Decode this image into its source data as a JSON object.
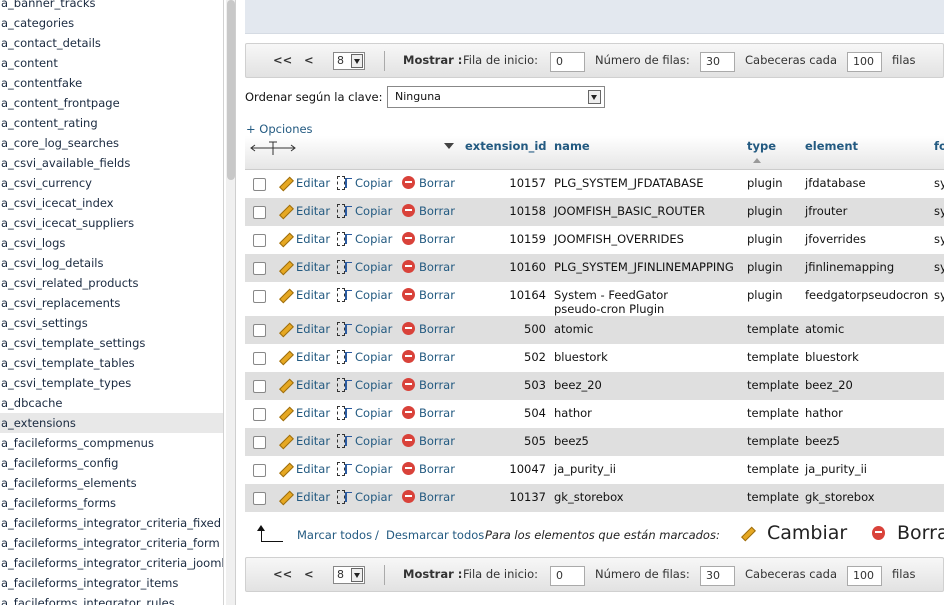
{
  "sidebar": {
    "tables": [
      "a_banner_tracks",
      "a_categories",
      "a_contact_details",
      "a_content",
      "a_contentfake",
      "a_content_frontpage",
      "a_content_rating",
      "a_core_log_searches",
      "a_csvi_available_fields",
      "a_csvi_currency",
      "a_csvi_icecat_index",
      "a_csvi_icecat_suppliers",
      "a_csvi_logs",
      "a_csvi_log_details",
      "a_csvi_related_products",
      "a_csvi_replacements",
      "a_csvi_settings",
      "a_csvi_template_settings",
      "a_csvi_template_tables",
      "a_csvi_template_types",
      "a_dbcache",
      "a_extensions",
      "a_facileforms_compmenus",
      "a_facileforms_config",
      "a_facileforms_elements",
      "a_facileforms_forms",
      "a_facileforms_integrator_criteria_fixed",
      "a_facileforms_integrator_criteria_form",
      "a_facileforms_integrator_criteria_joomla",
      "a_facileforms_integrator_items",
      "a_facileforms_integrator_rules"
    ],
    "active_index": 21
  },
  "nav": {
    "first": "<<",
    "prev": "<",
    "page": "8",
    "show_label": "Mostrar :",
    "start_row_label": "Fila de inicio:",
    "start_row_value": "0",
    "num_rows_label": "Número de filas:",
    "num_rows_value": "30",
    "headers_every_label": "Cabeceras cada",
    "headers_every_value": "100",
    "rows_label": "filas"
  },
  "order": {
    "label": "Ordenar según la clave:",
    "value": "Ninguna"
  },
  "options_link": "+ Opciones",
  "table": {
    "columns": {
      "extension_id": "extension_id",
      "name": "name",
      "type": "type",
      "element": "element",
      "folder": "fo"
    },
    "actions": {
      "edit": "Editar",
      "copy": "Copiar",
      "delete": "Borrar"
    },
    "rows": [
      {
        "id": "10157",
        "name": "PLG_SYSTEM_JFDATABASE",
        "name2": "",
        "type": "plugin",
        "element": "jfdatabase",
        "folder": "sy"
      },
      {
        "id": "10158",
        "name": "JOOMFISH_BASIC_ROUTER",
        "name2": "",
        "type": "plugin",
        "element": "jfrouter",
        "folder": "sy"
      },
      {
        "id": "10159",
        "name": "JOOMFISH_OVERRIDES",
        "name2": "",
        "type": "plugin",
        "element": "jfoverrides",
        "folder": "sy"
      },
      {
        "id": "10160",
        "name": "PLG_SYSTEM_JFINLINEMAPPING",
        "name2": "",
        "type": "plugin",
        "element": "jfinlinemapping",
        "folder": "sy"
      },
      {
        "id": "10164",
        "name": "System - FeedGator",
        "name2": "pseudo-cron Plugin",
        "type": "plugin",
        "element": "feedgatorpseudocron",
        "folder": "sy"
      },
      {
        "id": "500",
        "name": "atomic",
        "name2": "",
        "type": "template",
        "element": "atomic",
        "folder": ""
      },
      {
        "id": "502",
        "name": "bluestork",
        "name2": "",
        "type": "template",
        "element": "bluestork",
        "folder": ""
      },
      {
        "id": "503",
        "name": "beez_20",
        "name2": "",
        "type": "template",
        "element": "beez_20",
        "folder": ""
      },
      {
        "id": "504",
        "name": "hathor",
        "name2": "",
        "type": "template",
        "element": "hathor",
        "folder": ""
      },
      {
        "id": "505",
        "name": "beez5",
        "name2": "",
        "type": "template",
        "element": "beez5",
        "folder": ""
      },
      {
        "id": "10047",
        "name": "ja_purity_ii",
        "name2": "",
        "type": "template",
        "element": "ja_purity_ii",
        "folder": ""
      },
      {
        "id": "10137",
        "name": "gk_storebox",
        "name2": "",
        "type": "template",
        "element": "gk_storebox",
        "folder": ""
      }
    ]
  },
  "footer": {
    "mark_all": "Marcar todos",
    "separator": "/",
    "unmark_all": "Desmarcar todos",
    "for_marked": "Para los elementos que están marcados:",
    "change": "Cambiar",
    "delete": "Borra"
  },
  "colors": {
    "link": "#235a81",
    "row_alt": "#dfdfdf",
    "delete_icon": "#d9423a",
    "edit_icon": "#e6a822"
  }
}
